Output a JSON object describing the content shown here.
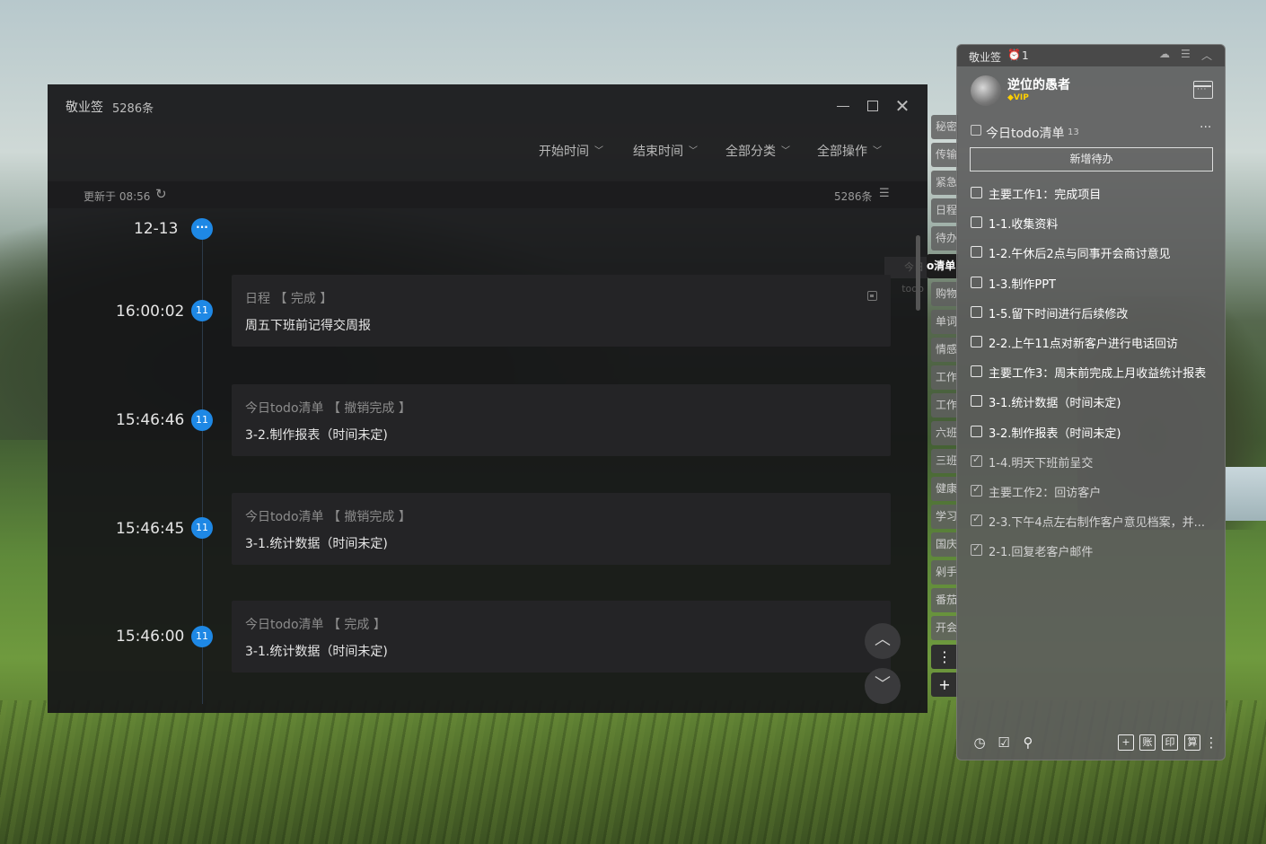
{
  "main_window": {
    "app_title": "敬业签",
    "count": "5286条",
    "filters": [
      "开始时间",
      "结束时间",
      "全部分类",
      "全部操作"
    ],
    "updated": "更新于 08:56",
    "total": "5286条",
    "date": "12-13",
    "date_dot": "···",
    "side_ghost": "今日todo",
    "entries": [
      {
        "time": "16:00:02",
        "badge": "11",
        "meta": "日程 【 完成 】",
        "content": "周五下班前记得交周报"
      },
      {
        "time": "15:46:46",
        "badge": "11",
        "meta": "今日todo清单 【 撤销完成 】",
        "content": "3-2.制作报表（时间未定)"
      },
      {
        "time": "15:46:45",
        "badge": "11",
        "meta": "今日todo清单 【 撤销完成 】",
        "content": "3-1.统计数据（时间未定)"
      },
      {
        "time": "15:46:00",
        "badge": "11",
        "meta": "今日todo清单 【 完成 】",
        "content": "3-1.统计数据（时间未定)"
      }
    ]
  },
  "side_tabs": [
    "秘密",
    "传输",
    "紧急",
    "日程",
    "待办",
    "o清单",
    "购物",
    "单词",
    "情感",
    "工作",
    "工作",
    "六班",
    "三班",
    "健康",
    "学习",
    "国庆",
    "剁手",
    "番茄",
    "开会"
  ],
  "panel": {
    "title": "敬业签",
    "notify_count": "1",
    "username": "逆位的愚者",
    "vip": "VIP",
    "list_title": "今日todo清单",
    "list_count": "13",
    "add_button": "新增待办",
    "todos": [
      {
        "text": "主要工作1：完成项目",
        "done": false
      },
      {
        "text": "1-1.收集资料",
        "done": false
      },
      {
        "text": "1-2.午休后2点与同事开会商讨意见",
        "done": false
      },
      {
        "text": "1-3.制作PPT",
        "done": false
      },
      {
        "text": "1-5.留下时间进行后续修改",
        "done": false
      },
      {
        "text": "2-2.上午11点对新客户进行电话回访",
        "done": false
      },
      {
        "text": "主要工作3：周末前完成上月收益统计报表",
        "done": false
      },
      {
        "text": "3-1.统计数据（时间未定)",
        "done": false
      },
      {
        "text": "3-2.制作报表（时间未定)",
        "done": false
      },
      {
        "text": "1-4.明天下班前呈交",
        "done": true
      },
      {
        "text": "主要工作2：回访客户",
        "done": true
      },
      {
        "text": "2-3.下午4点左右制作客户意见档案，并...",
        "done": true
      },
      {
        "text": "2-1.回复老客户邮件",
        "done": true
      }
    ],
    "bottom_boxes": [
      "+",
      "账",
      "印",
      "算"
    ]
  },
  "colors": {
    "accent": "#1e88e5",
    "alert": "#ff4d4d",
    "vip": "#ffd000"
  }
}
